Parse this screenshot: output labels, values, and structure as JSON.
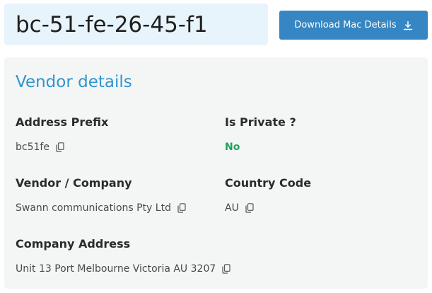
{
  "mac": {
    "address": "bc-51-fe-26-45-f1"
  },
  "download": {
    "label": "Download Mac Details",
    "icon": "download-icon"
  },
  "vendor": {
    "heading": "Vendor details",
    "fields": {
      "address_prefix": {
        "label": "Address Prefix",
        "value": "bc51fe"
      },
      "is_private": {
        "label": "Is Private ?",
        "value": "No"
      },
      "company": {
        "label": "Vendor / Company",
        "value": "Swann communications Pty Ltd"
      },
      "country_code": {
        "label": "Country Code",
        "value": "AU"
      },
      "company_address": {
        "label": "Company Address",
        "value": "Unit 13 Port Melbourne Victoria AU 3207"
      }
    },
    "copy_icon": "copy-icon"
  },
  "colors": {
    "accent": "#3586c2",
    "heading": "#2f96cf",
    "positive": "#1fa35a",
    "mac_bg": "#e8f4fb",
    "card_bg": "#f4f5f5"
  }
}
